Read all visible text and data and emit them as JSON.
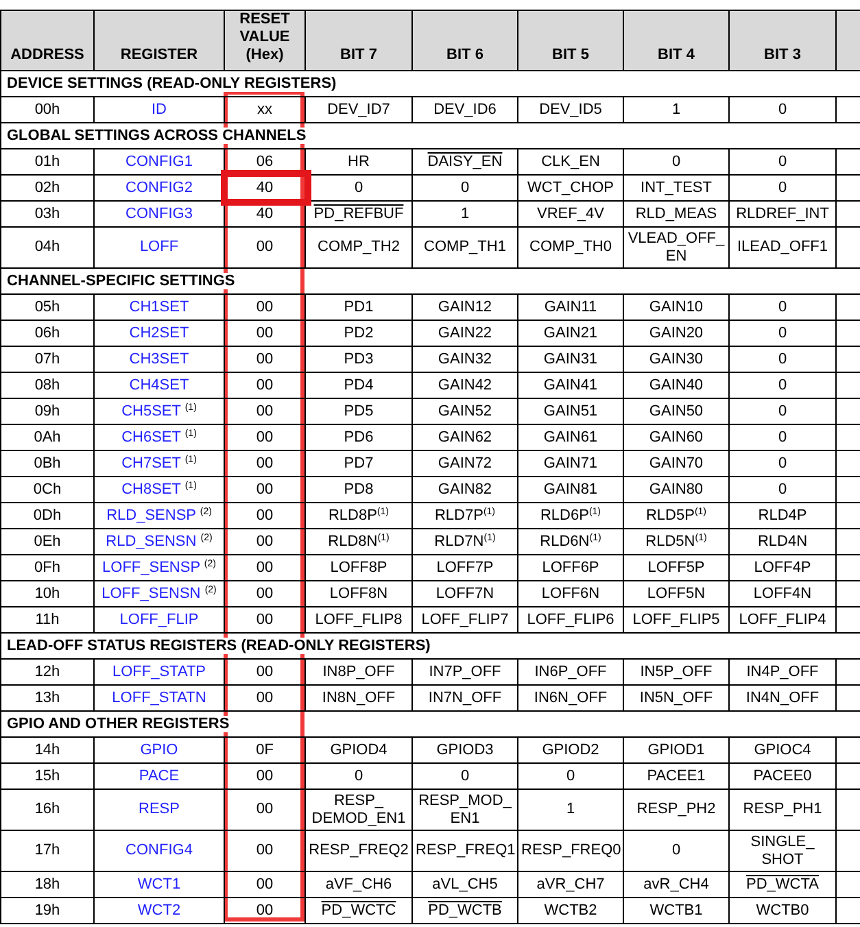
{
  "columns": [
    "ADDRESS",
    "REGISTER",
    "RESET VALUE (Hex)",
    "BIT 7",
    "BIT 6",
    "BIT 5",
    "BIT 4",
    "BIT 3"
  ],
  "reset_column_outlined": true,
  "sections": [
    {
      "title": "DEVICE SETTINGS (READ-ONLY REGISTERS)",
      "rows": [
        {
          "address": "00h",
          "register": "ID",
          "reset": "xx",
          "highlighted": false,
          "bits": [
            "DEV_ID7",
            "DEV_ID6",
            "DEV_ID5",
            "1",
            "0"
          ]
        }
      ]
    },
    {
      "title": "GLOBAL SETTINGS ACROSS CHANNELS",
      "rows": [
        {
          "address": "01h",
          "register": "CONFIG1",
          "reset": "06",
          "highlighted": false,
          "bits": [
            "HR",
            {
              "text": "DAISY_EN",
              "overline": true
            },
            "CLK_EN",
            "0",
            "0"
          ]
        },
        {
          "address": "02h",
          "register": "CONFIG2",
          "reset": "40",
          "highlighted": true,
          "bits": [
            "0",
            "0",
            "WCT_CHOP",
            "INT_TEST",
            "0"
          ]
        },
        {
          "address": "03h",
          "register": "CONFIG3",
          "reset": "40",
          "highlighted": false,
          "bits": [
            {
              "text": "PD_REFBUF",
              "overline": true
            },
            "1",
            "VREF_4V",
            "RLD_MEAS",
            "RLDREF_INT"
          ]
        },
        {
          "address": "04h",
          "register": "LOFF",
          "reset": "00",
          "highlighted": false,
          "bits": [
            "COMP_TH2",
            "COMP_TH1",
            "COMP_TH0",
            "VLEAD_OFF_\nEN",
            "ILEAD_OFF1"
          ]
        }
      ]
    },
    {
      "title": "CHANNEL-SPECIFIC SETTINGS",
      "rows": [
        {
          "address": "05h",
          "register": "CH1SET",
          "reset": "00",
          "highlighted": false,
          "bits": [
            "PD1",
            "GAIN12",
            "GAIN11",
            "GAIN10",
            "0"
          ]
        },
        {
          "address": "06h",
          "register": "CH2SET",
          "reset": "00",
          "highlighted": false,
          "bits": [
            "PD2",
            "GAIN22",
            "GAIN21",
            "GAIN20",
            "0"
          ]
        },
        {
          "address": "07h",
          "register": "CH3SET",
          "reset": "00",
          "highlighted": false,
          "bits": [
            "PD3",
            "GAIN32",
            "GAIN31",
            "GAIN30",
            "0"
          ]
        },
        {
          "address": "08h",
          "register": "CH4SET",
          "reset": "00",
          "highlighted": false,
          "bits": [
            "PD4",
            "GAIN42",
            "GAIN41",
            "GAIN40",
            "0"
          ]
        },
        {
          "address": "09h",
          "register": "CH5SET $^{(1)}$",
          "reset": "00",
          "highlighted": false,
          "bits": [
            "PD5",
            "GAIN52",
            "GAIN51",
            "GAIN50",
            "0"
          ]
        },
        {
          "address": "0Ah",
          "register": "CH6SET $^{(1)}$",
          "reset": "00",
          "highlighted": false,
          "bits": [
            "PD6",
            "GAIN62",
            "GAIN61",
            "GAIN60",
            "0"
          ]
        },
        {
          "address": "0Bh",
          "register": "CH7SET $^{(1)}$",
          "reset": "00",
          "highlighted": false,
          "bits": [
            "PD7",
            "GAIN72",
            "GAIN71",
            "GAIN70",
            "0"
          ]
        },
        {
          "address": "0Ch",
          "register": "CH8SET $^{(1)}$",
          "reset": "00",
          "highlighted": false,
          "bits": [
            "PD8",
            "GAIN82",
            "GAIN81",
            "GAIN80",
            "0"
          ]
        },
        {
          "address": "0Dh",
          "register": "RLD_SENSP $^{(2)}$",
          "reset": "00",
          "highlighted": false,
          "bits": [
            "RLD8P$^{(1)}$",
            "RLD7P$^{(1)}$",
            "RLD6P$^{(1)}$",
            "RLD5P$^{(1)}$",
            "RLD4P"
          ]
        },
        {
          "address": "0Eh",
          "register": "RLD_SENSN $^{(2)}$",
          "reset": "00",
          "highlighted": false,
          "bits": [
            "RLD8N$^{(1)}$",
            "RLD7N$^{(1)}$",
            "RLD6N$^{(1)}$",
            "RLD5N$^{(1)}$",
            "RLD4N"
          ]
        },
        {
          "address": "0Fh",
          "register": "LOFF_SENSP $^{(2)}$",
          "reset": "00",
          "highlighted": false,
          "bits": [
            "LOFF8P",
            "LOFF7P",
            "LOFF6P",
            "LOFF5P",
            "LOFF4P"
          ]
        },
        {
          "address": "10h",
          "register": "LOFF_SENSN $^{(2)}$",
          "reset": "00",
          "highlighted": false,
          "bits": [
            "LOFF8N",
            "LOFF7N",
            "LOFF6N",
            "LOFF5N",
            "LOFF4N"
          ]
        },
        {
          "address": "11h",
          "register": "LOFF_FLIP",
          "reset": "00",
          "highlighted": false,
          "bits": [
            "LOFF_FLIP8",
            "LOFF_FLIP7",
            "LOFF_FLIP6",
            "LOFF_FLIP5",
            "LOFF_FLIP4"
          ]
        }
      ]
    },
    {
      "title": "LEAD-OFF STATUS REGISTERS (READ-ONLY REGISTERS)",
      "rows": [
        {
          "address": "12h",
          "register": "LOFF_STATP",
          "reset": "00",
          "highlighted": false,
          "bits": [
            "IN8P_OFF",
            "IN7P_OFF",
            "IN6P_OFF",
            "IN5P_OFF",
            "IN4P_OFF"
          ]
        },
        {
          "address": "13h",
          "register": "LOFF_STATN",
          "reset": "00",
          "highlighted": false,
          "bits": [
            "IN8N_OFF",
            "IN7N_OFF",
            "IN6N_OFF",
            "IN5N_OFF",
            "IN4N_OFF"
          ]
        }
      ]
    },
    {
      "title": "GPIO AND OTHER REGISTERS",
      "rows": [
        {
          "address": "14h",
          "register": "GPIO",
          "reset": "0F",
          "highlighted": false,
          "bits": [
            "GPIOD4",
            "GPIOD3",
            "GPIOD2",
            "GPIOD1",
            "GPIOC4"
          ]
        },
        {
          "address": "15h",
          "register": "PACE",
          "reset": "00",
          "highlighted": false,
          "bits": [
            "0",
            "0",
            "0",
            "PACEE1",
            "PACEE0"
          ]
        },
        {
          "address": "16h",
          "register": "RESP",
          "reset": "00",
          "highlighted": false,
          "bits": [
            "RESP_\nDEMOD_EN1",
            "RESP_MOD_\nEN1",
            "1",
            "RESP_PH2",
            "RESP_PH1"
          ]
        },
        {
          "address": "17h",
          "register": "CONFIG4",
          "reset": "00",
          "highlighted": false,
          "bits": [
            "RESP_FREQ2",
            "RESP_FREQ1",
            "RESP_FREQ0",
            "0",
            "SINGLE_\nSHOT"
          ]
        },
        {
          "address": "18h",
          "register": "WCT1",
          "reset": "00",
          "highlighted": false,
          "bits": [
            "aVF_CH6",
            "aVL_CH5",
            "aVR_CH7",
            "avR_CH4",
            {
              "text": "PD_WCTA",
              "overline": true
            }
          ]
        },
        {
          "address": "19h",
          "register": "WCT2",
          "reset": "00",
          "highlighted": false,
          "bits": [
            {
              "text": "PD_WCTC",
              "overline": true
            },
            {
              "text": "PD_WCTB",
              "overline": true
            },
            "WCTB2",
            "WCTB1",
            "WCTB0"
          ]
        }
      ]
    }
  ]
}
